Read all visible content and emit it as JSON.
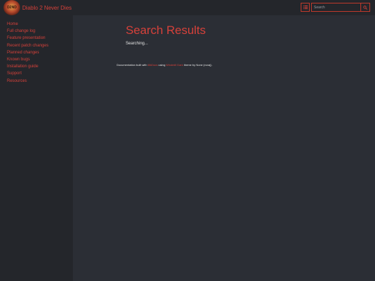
{
  "header": {
    "logo_text": "D2ND",
    "site_title": "Diablo 2 Never Dies",
    "search": {
      "placeholder": "Search",
      "value": ""
    }
  },
  "sidebar": {
    "items": [
      {
        "label": "Home"
      },
      {
        "label": "Full change log"
      },
      {
        "label": "Feature presentation"
      },
      {
        "label": "Recent patch changes"
      },
      {
        "label": "Planned changes"
      },
      {
        "label": "Known bugs"
      },
      {
        "label": "Installation guide"
      },
      {
        "label": "Support"
      },
      {
        "label": "Resources"
      }
    ]
  },
  "main": {
    "title": "Search Results",
    "status": "Searching...",
    "footer": {
      "prefix": "Documentation built with",
      "link1": "MkDocs",
      "mid": "using",
      "link2": "Windmill Dark",
      "suffix": "theme by None (noraj)."
    }
  },
  "colors": {
    "accent": "#d6413a",
    "background": "#2b2e35",
    "panel": "#24262b",
    "text": "#e6e6e6"
  },
  "icons": {
    "menu": "list-icon",
    "search": "magnifier-icon"
  }
}
